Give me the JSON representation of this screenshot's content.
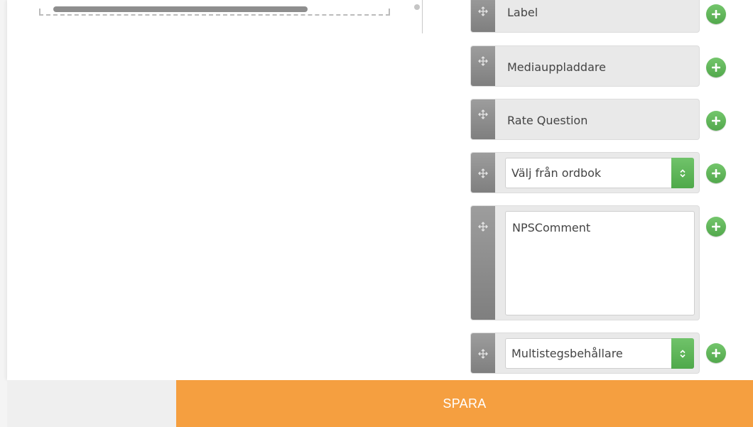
{
  "components": [
    {
      "type": "button",
      "label": "Label"
    },
    {
      "type": "button",
      "label": "Mediauppladdare"
    },
    {
      "type": "button",
      "label": "Rate Question"
    },
    {
      "type": "select",
      "value": "Välj från ordbok"
    },
    {
      "type": "textarea",
      "value": "NPSComment"
    },
    {
      "type": "select",
      "value": "Multistegsbehållare"
    }
  ],
  "icons": {
    "drag": "move-icon",
    "add": "plus-icon",
    "select_arrows": "updown-chevron-icon"
  },
  "colors": {
    "accent_orange": "#f59f40",
    "add_green": "#5cb85c",
    "handle_gray": "#8e8e8e"
  },
  "footer": {
    "save_label": "SPARA"
  }
}
